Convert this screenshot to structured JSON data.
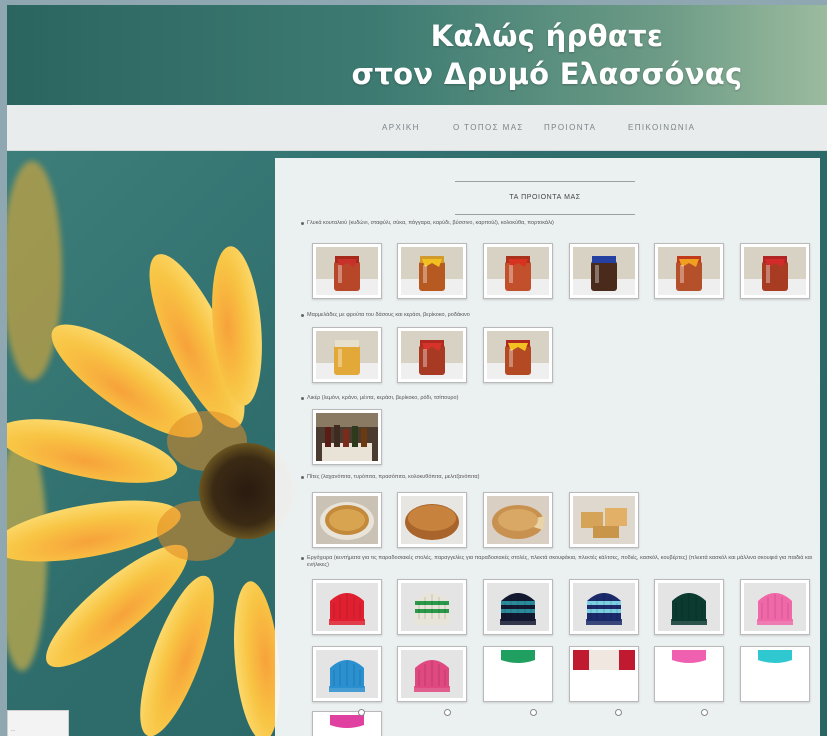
{
  "header": {
    "title_line1": "Καλώς ήρθατε",
    "title_line2": "στον Δρυμό Ελασσόνας"
  },
  "nav": {
    "items": [
      "ΑΡΧΙΚΗ",
      "Ο ΤΟΠΟΣ ΜΑΣ",
      "ΠΡΟΙΟΝΤΑ",
      "ΕΠΙΚΟΙΝΩΝΙΑ"
    ]
  },
  "content": {
    "section_title": "ΤΑ ΠΡΟΙΟΝΤΑ ΜΑΣ",
    "categories": [
      {
        "label": "Γλυκά κουταλιού (κυδώνι, σταφύλι, σύκα, πάγγαρα, καρύδι, βύσσινο, καρπούζι, κολοκύθα, πορτοκάλι)",
        "items": [
          "jar-red-lid",
          "jar-yellow-ribbon",
          "jar-red-ribbon",
          "jar-blue-lid",
          "jar-orange-ribbon",
          "jar-red-cloth"
        ]
      },
      {
        "label": "Μαρμελάδες με φρούτα του δάσους και κεράσι, βερίκοκο, ροδάκινο",
        "items": [
          "jar-honey",
          "jar-red-lid-2",
          "jar-yellow-ribbon-2"
        ]
      },
      {
        "label": "Λικέρ (λεμόνι, κράνο, μέντα, κεράσι, βερίκοκο, ρόδι, τσίπουρο)",
        "items": [
          "liqueur-bottles"
        ]
      },
      {
        "label": "Πίτες (λαχανόπιτα, τυρόπιτα, πρασόπιτα, κολοκυθόπιτα, μελιτζανόπιτα)",
        "items": [
          "pie-round",
          "pie-bread",
          "pie-sliced",
          "pie-pieces"
        ]
      },
      {
        "label": "Εργόχειρα (κεντήματα για τις παραδοσιακές στολές, παραγγελίες για παραδοσιακές στολές, πλεκτά σκουφάκια, πλεκτές κάλτσες, ποδιές, κασκόλ, κουβέρτες) (πλεκτά κασκόλ και μάλλινα σκουφιά για παιδιά και ενήλικες)",
        "items": [
          "beanie-red",
          "beanie-striped",
          "beanie-navy",
          "beanie-stripe-blue",
          "beanie-green",
          "beanie-pink",
          "beanie-blue",
          "beanie-pink-2",
          "beanie-green-cut",
          "beanie-red-cut",
          "beanie-pink-cut",
          "beanie-cyan-cut",
          "beanie-magenta-cut"
        ]
      }
    ]
  },
  "taskbar": {
    "text": "..."
  },
  "colors": {
    "header_start": "#2b6560",
    "header_end": "#9bbb9e",
    "nav_text": "#7b8388",
    "panel_bg": "#f6f8f8",
    "petal": "#f5c23a"
  }
}
